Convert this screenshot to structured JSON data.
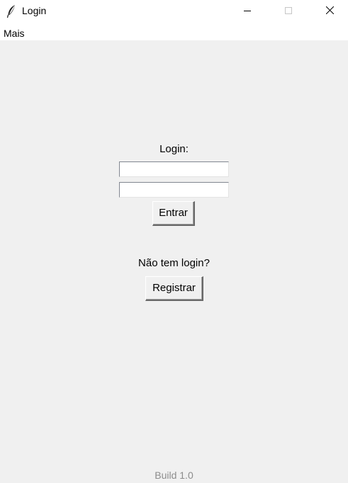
{
  "window": {
    "title": "Login",
    "icon": "feather-icon",
    "controls": [
      "minimize-icon",
      "maximize-icon",
      "close-icon"
    ]
  },
  "menubar": {
    "items": [
      {
        "label": "Mais"
      }
    ]
  },
  "login_form": {
    "label": "Login:",
    "username_value": "",
    "password_value": "",
    "submit_label": "Entrar"
  },
  "register": {
    "prompt": "Não tem login?",
    "button_label": "Registrar"
  },
  "footer": {
    "build": "Build 1.0"
  },
  "colors": {
    "background": "#f0f0f0",
    "titlebar": "#ffffff",
    "build_text": "#8c8c8c"
  }
}
